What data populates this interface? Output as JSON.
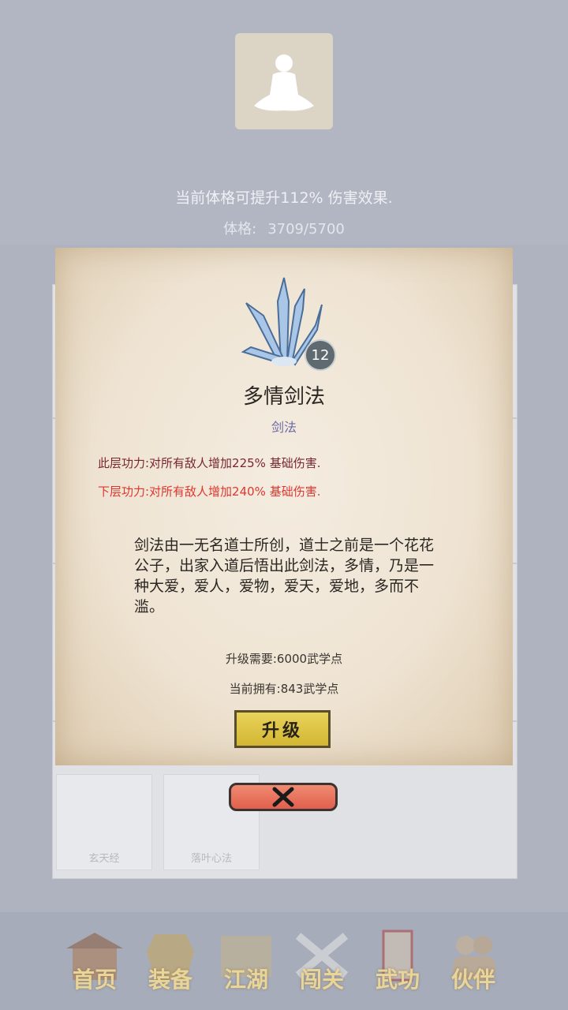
{
  "header": {
    "effect_text": "当前体格可提升112% 伤害效果.",
    "stat_label": "体格:",
    "stat_value": "3709/5700"
  },
  "skill": {
    "level": "12",
    "name": "多情剑法",
    "type": "剑法",
    "current_effect": "此层功力:对所有敌人增加225% 基础伤害.",
    "next_effect": "下层功力:对所有敌人增加240% 基础伤害.",
    "description": "剑法由一无名道士所创，道士之前是一个花花公子，出家入道后悟出此剑法，多情，乃是一种大爱，爱人，爱物，爱天，爱地，多而不滥。",
    "upgrade_cost": "升级需要:6000武学点",
    "current_points": "当前拥有:843武学点",
    "upgrade_label": "升级",
    "colors": {
      "current_effect": "#7a2630",
      "next_effect": "#e0362e",
      "type": "#6b69a8"
    }
  },
  "list_cards": [
    {
      "label": "玄天经"
    },
    {
      "label": "落叶心法"
    }
  ],
  "nav": [
    {
      "label": "首页",
      "icon": "house-icon"
    },
    {
      "label": "装备",
      "icon": "armor-icon"
    },
    {
      "label": "江湖",
      "icon": "map-icon"
    },
    {
      "label": "闯关",
      "icon": "swords-icon"
    },
    {
      "label": "武功",
      "icon": "book-icon"
    },
    {
      "label": "伙伴",
      "icon": "partners-icon"
    }
  ]
}
